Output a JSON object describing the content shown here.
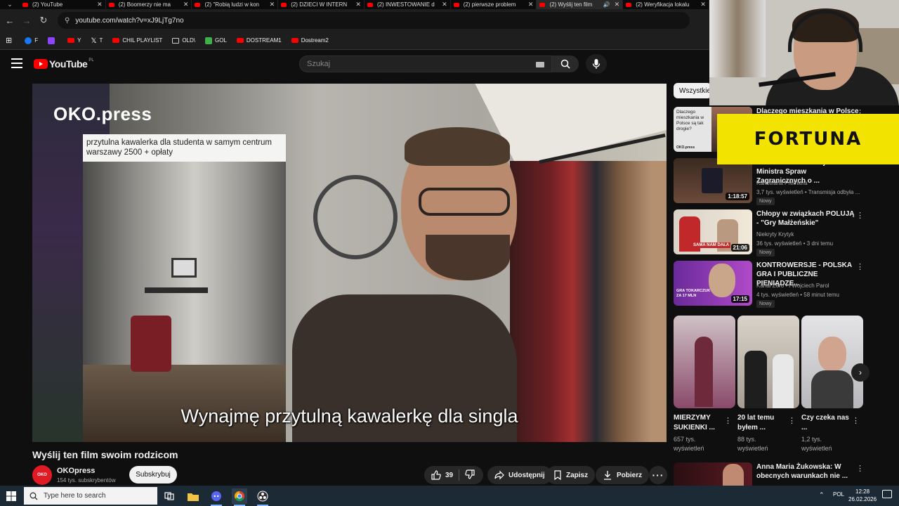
{
  "browser": {
    "tabs": [
      {
        "label": "(2) YouTube",
        "active": false
      },
      {
        "label": "(2) Boomerzy nie ma",
        "active": false
      },
      {
        "label": "(2) \"Robią ludzi w kon",
        "active": false
      },
      {
        "label": "(2) DZIECI W INTERN",
        "active": false
      },
      {
        "label": "(2) INWESTOWANIE d",
        "active": false
      },
      {
        "label": "(2) pierwsze problem",
        "active": false
      },
      {
        "label": "(2) Wyślij ten film",
        "active": true
      },
      {
        "label": "(2) Weryfikacja lokalu",
        "active": false
      }
    ],
    "url": "youtube.com/watch?v=xJ9LjTg7no",
    "bookmarks": [
      {
        "label": "F",
        "icon": "facebook-icon"
      },
      {
        "label": "",
        "icon": "twitch-icon"
      },
      {
        "label": "Y",
        "icon": "youtube-icon"
      },
      {
        "label": "T",
        "icon": "x-icon"
      },
      {
        "label": "CHIL PLAYLIST",
        "icon": "youtube-icon"
      },
      {
        "label": "OLD\\",
        "icon": "folder-icon"
      },
      {
        "label": "GOL",
        "icon": "gol-icon"
      },
      {
        "label": "DOSTREAM1",
        "icon": "youtube-icon"
      },
      {
        "label": "Dostream2",
        "icon": "youtube-icon"
      }
    ]
  },
  "youtube": {
    "logo_text": "YouTube",
    "logo_region": "PL",
    "search_placeholder": "Szukaj",
    "chip": "Wszystkie"
  },
  "video": {
    "brand_overlay": "OKO.press",
    "caption": "przytulna kawalerka dla studenta w samym centrum warszawy 2500 + opłaty",
    "subtitle": "Wynajmę przytulną kawalerkę dla singla",
    "title": "Wyślij ten film swoim rodzicom",
    "channel": {
      "name": "OKOpress",
      "subs": "154 tys. subskrybentów",
      "avatar_text": "OKO"
    },
    "subscribe_label": "Subskrybuj",
    "like_count": "39",
    "share_label": "Udostępnij",
    "save_label": "Zapisz",
    "download_label": "Pobierz"
  },
  "recommendations": [
    {
      "title": "Dlaczego mieszkania w Polsce są tak drogie? #ShortsTok",
      "thumb_text": "Dlaczego mieszkania w Polsce są tak drogie?",
      "thumb_brand": "OKO.press",
      "meta": [],
      "duration": "",
      "badge": ""
    },
    {
      "title": "NA ŻYWO: Informacja Ministra Spraw Zagranicznych o ...",
      "meta": [
        "Kancelaria Premiera",
        "3,7 tys. wyświetleń • Transmisja odbyła ..."
      ],
      "duration": "1:18:57",
      "badge": "Nowy"
    },
    {
      "title": "Chłopy w związkach POLUJĄ - \"Gry Małżeńskie\"",
      "meta": [
        "Niekryty Krytyk",
        "36 tys. wyświetleń • 3 dni temu"
      ],
      "duration": "21:06",
      "thumb_text": "SAMA NAM DAŁA",
      "badge": "Nowy"
    },
    {
      "title": "KONTROWERSJE - POLSKA GRA I PUBLICZNE PIENIĄDZE...",
      "meta": [
        "Kanał Zero • i Wojciech Parol",
        "4 tys. wyświetleń • 58 minut temu"
      ],
      "duration": "17:15",
      "thumb_text": "GRA TOKARCZUK ZA 17 MLN",
      "badge": "Nowy"
    },
    {
      "title": "Anna Maria Żukowska: W obecnych warunkach nie ...",
      "meta": [],
      "duration": "",
      "badge": ""
    }
  ],
  "shorts": [
    {
      "title": "MIERZYMY SUKIENKI ...",
      "views": "657 tys. wyświetleń"
    },
    {
      "title": "20 lat temu byłem ...",
      "views": "88 tys. wyświetleń"
    },
    {
      "title": "Czy czeka nas ...",
      "views": "1,2 tys. wyświetleń"
    }
  ],
  "overlay": {
    "sponsor": "FORTUNA"
  },
  "taskbar": {
    "search_placeholder": "Type here to search",
    "lang": "POL",
    "time": "12:28",
    "date": "26.02.2026"
  },
  "colors": {
    "yt_red": "#ff0000",
    "fortuna_yellow": "#f2e400",
    "bg": "#0f0f0f"
  }
}
